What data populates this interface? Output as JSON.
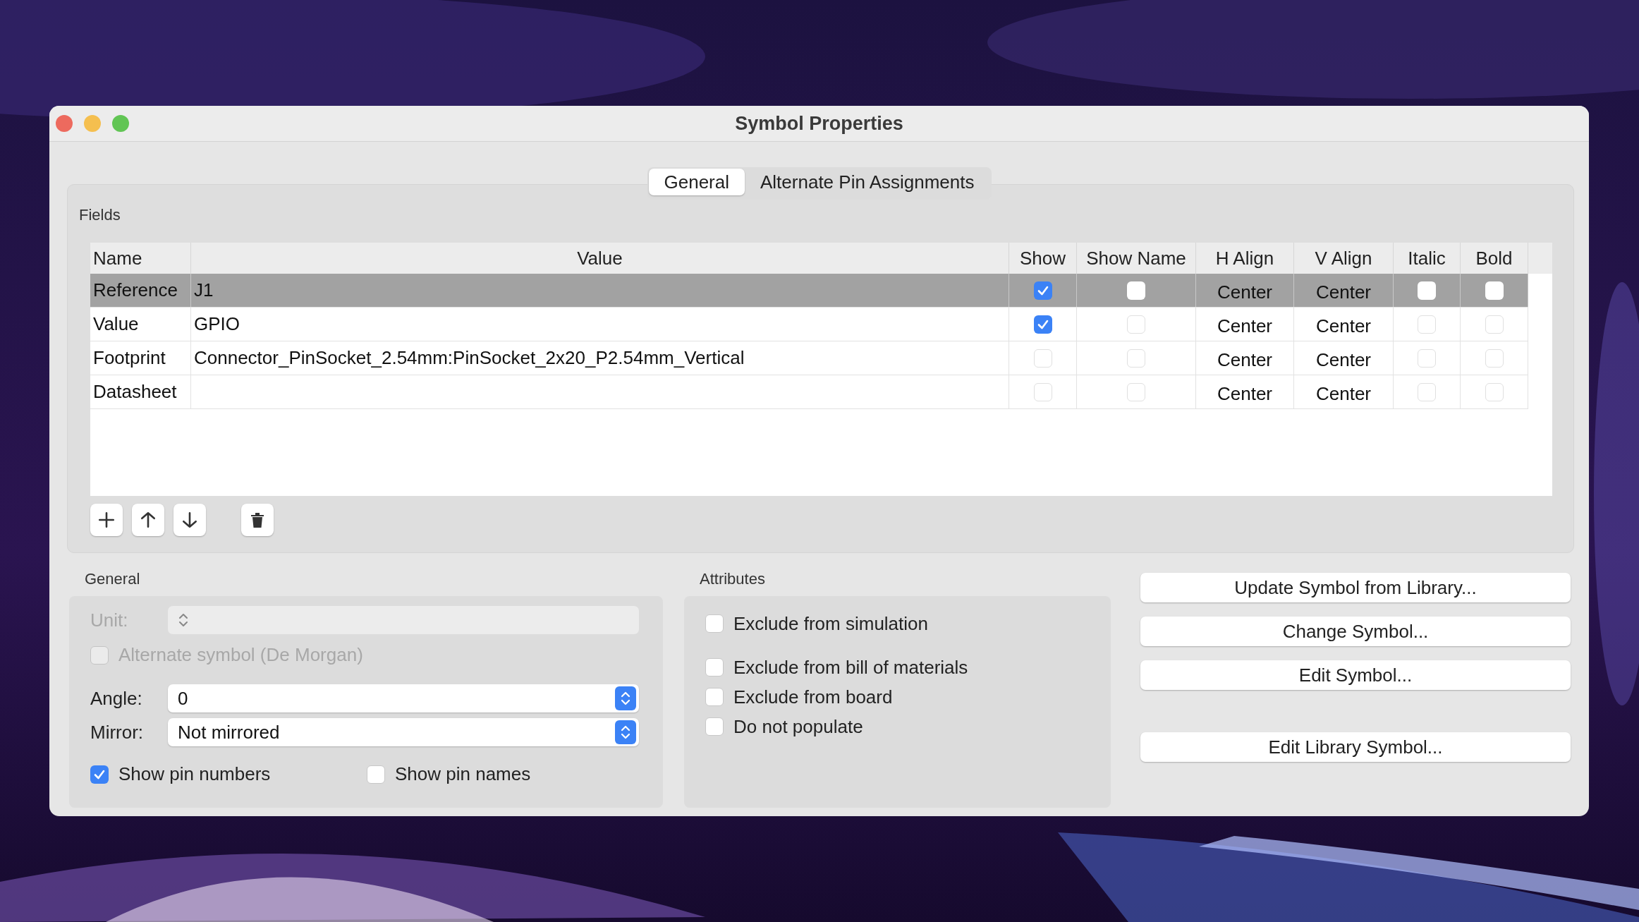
{
  "window": {
    "title": "Symbol Properties"
  },
  "tabs": [
    {
      "label": "General",
      "selected": true
    },
    {
      "label": "Alternate Pin Assignments",
      "selected": false
    }
  ],
  "fields": {
    "label": "Fields",
    "columns": [
      "Name",
      "Value",
      "Show",
      "Show Name",
      "H Align",
      "V Align",
      "Italic",
      "Bold"
    ],
    "rows": [
      {
        "name": "Reference",
        "value": "J1",
        "show": true,
        "show_name": false,
        "h_align": "Center",
        "v_align": "Center",
        "italic": false,
        "bold": false,
        "selected": true
      },
      {
        "name": "Value",
        "value": "GPIO",
        "show": true,
        "show_name": false,
        "h_align": "Center",
        "v_align": "Center",
        "italic": false,
        "bold": false,
        "selected": false
      },
      {
        "name": "Footprint",
        "value": "Connector_PinSocket_2.54mm:PinSocket_2x20_P2.54mm_Vertical",
        "show": false,
        "show_name": false,
        "h_align": "Center",
        "v_align": "Center",
        "italic": false,
        "bold": false,
        "selected": false
      },
      {
        "name": "Datasheet",
        "value": "",
        "show": false,
        "show_name": false,
        "h_align": "Center",
        "v_align": "Center",
        "italic": false,
        "bold": false,
        "selected": false
      }
    ]
  },
  "general": {
    "label": "General",
    "unit": {
      "label": "Unit:",
      "disabled": true
    },
    "alternate_symbol": {
      "label": "Alternate symbol (De Morgan)",
      "checked": false,
      "disabled": true
    },
    "angle": {
      "label": "Angle:",
      "value": "0"
    },
    "mirror": {
      "label": "Mirror:",
      "value": "Not mirrored"
    },
    "pin_options": [
      {
        "label": "Show pin numbers",
        "checked": true
      },
      {
        "label": "Show pin names",
        "checked": false
      }
    ]
  },
  "attributes": {
    "label": "Attributes",
    "options": [
      {
        "label": "Exclude from simulation",
        "checked": false
      },
      {
        "label": "Exclude from bill of materials",
        "checked": false
      },
      {
        "label": "Exclude from board",
        "checked": false
      },
      {
        "label": "Do not populate",
        "checked": false
      }
    ]
  },
  "actions": [
    "Update Symbol from Library...",
    "Change Symbol...",
    "Edit Symbol...",
    "Edit Library Symbol..."
  ]
}
